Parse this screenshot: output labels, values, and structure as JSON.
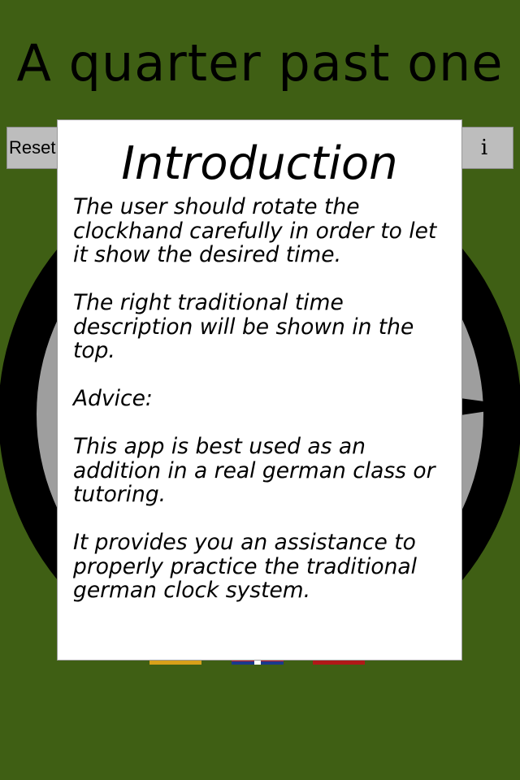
{
  "header": {
    "title": "A quarter past one"
  },
  "toolbar": {
    "reset_label": "Reset",
    "info_label": "i"
  },
  "flags": [
    {
      "name": "german-flag",
      "color": "#d8a01a"
    },
    {
      "name": "uk-flag",
      "color": "#1b3a8c"
    },
    {
      "name": "red-flag",
      "color": "#b01818"
    }
  ],
  "intro_dialog": {
    "title": "Introduction",
    "paragraphs": [
      "The user should rotate the clockhand carefully in order to let it show the desired time.",
      "The right traditional time description will be shown in the top.",
      "Advice:",
      "This app is best used as an addition in a real german class or tutoring.",
      "It provides you an assistance to properly practice the traditional german clock system."
    ]
  },
  "colors": {
    "background": "#3f5f14",
    "clock_ring": "#000000",
    "clock_face": "#9e9e9e",
    "dialog_background": "#ffffff",
    "button_background": "#bdbdbd"
  }
}
